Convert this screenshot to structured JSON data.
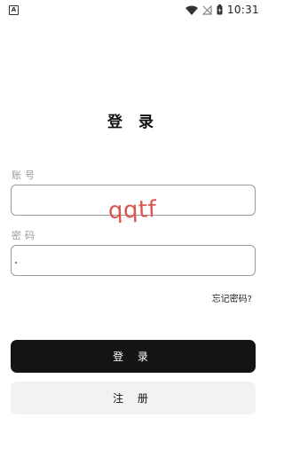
{
  "status_bar": {
    "notification_icon": "A",
    "time": "10:31",
    "icons": [
      "wifi-icon",
      "signal-off-icon",
      "battery-charging-icon"
    ]
  },
  "page": {
    "title": "登 录"
  },
  "form": {
    "account_label": "账号",
    "account_value": "",
    "password_label": "密码",
    "password_value": "",
    "captcha_text": "qqtf",
    "forgot_password": "忘记密码?"
  },
  "buttons": {
    "login_label": "登 录",
    "register_label": "注 册"
  },
  "colors": {
    "primary_button": "#141414",
    "secondary_button": "#f2f2f2",
    "captcha": "#d9534f",
    "label": "#9a9a9a"
  }
}
